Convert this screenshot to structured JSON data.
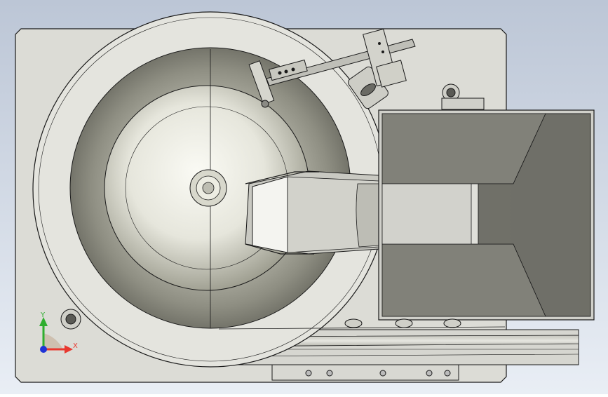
{
  "viewport": {
    "background_top": "#bcc6d6",
    "background_bottom": "#e9eef5"
  },
  "model": {
    "plate_color": "#dcdcd6",
    "bowl_rim_color": "#e4e4de",
    "bowl_inner_color": "#8e8e84",
    "bowl_floor_color": "#f1f1ea",
    "chute_color": "#80807a",
    "chute_light_color": "#d2d2cc",
    "edge_color": "#1a1a1a"
  },
  "triad": {
    "x_label": "X",
    "y_label": "Y",
    "x_color": "#e8382f",
    "y_color": "#2fae2f",
    "z_color": "#1f33d6"
  }
}
